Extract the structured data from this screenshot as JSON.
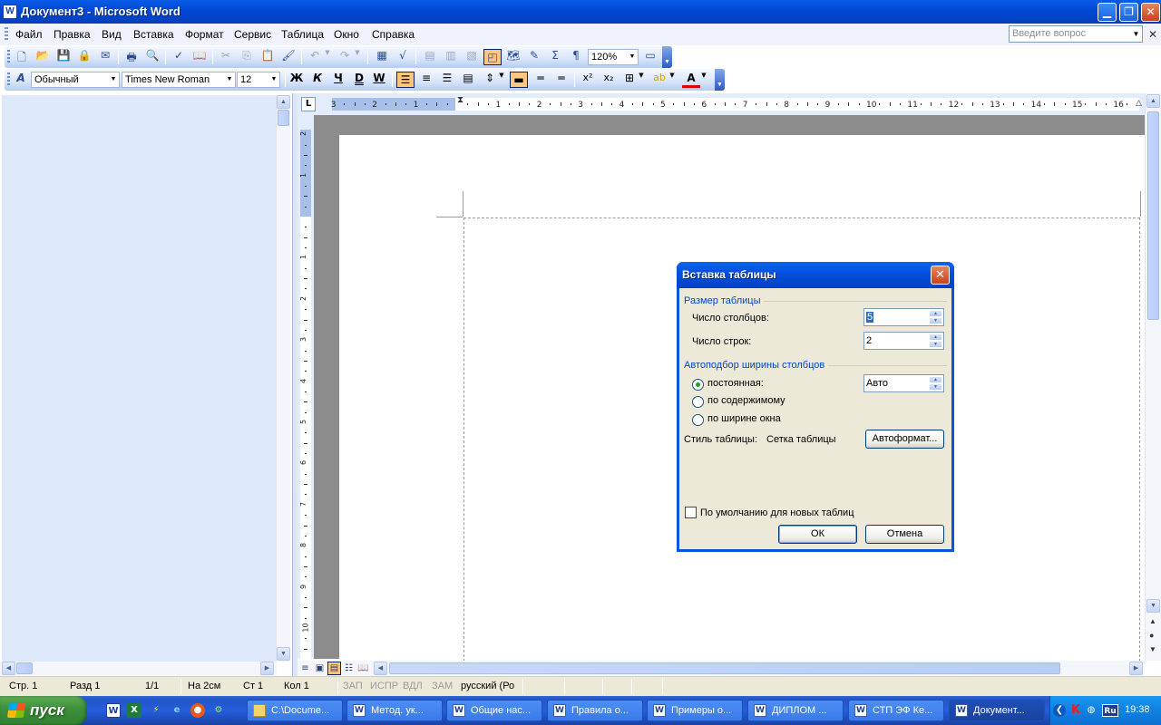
{
  "window": {
    "title": "Документ3 - Microsoft Word",
    "app_icon": "W"
  },
  "menu": {
    "items": [
      "Файл",
      "Правка",
      "Вид",
      "Вставка",
      "Формат",
      "Сервис",
      "Таблица",
      "Окно",
      "Справка"
    ],
    "ask_placeholder": "Введите вопрос"
  },
  "toolbar_standard": {
    "zoom": "120%"
  },
  "toolbar_formatting": {
    "style": "Обычный",
    "font": "Times New Roman",
    "size": "12"
  },
  "ruler": {
    "h_numbers": [
      "3",
      "2",
      "1",
      "1",
      "2",
      "3",
      "4",
      "5",
      "6",
      "7",
      "8",
      "9",
      "10",
      "11",
      "12",
      "13",
      "14",
      "15",
      "16"
    ],
    "v_numbers": [
      "2",
      "1",
      "1",
      "2",
      "3",
      "4",
      "5",
      "6",
      "7",
      "8",
      "9",
      "10"
    ]
  },
  "status": {
    "page": "Стр. 1",
    "section": "Разд 1",
    "pages": "1/1",
    "at": "На 2см",
    "line": "Ст 1",
    "col": "Кол 1",
    "rec": "ЗАП",
    "trk": "ИСПР",
    "ext": "ВДЛ",
    "ovr": "ЗАМ",
    "lang": "русский (Ро"
  },
  "taskbar": {
    "start": "пуск",
    "tasks": [
      "C:\\Docume...",
      "Метод. ук...",
      "Общие нас...",
      "Правила о...",
      "Примеры о...",
      "ДИПЛОМ ...",
      "СТП ЭФ Ке...",
      "Документ..."
    ],
    "clock": "19:38",
    "lang": "Ru"
  },
  "dialog": {
    "title": "Вставка таблицы",
    "size_group": "Размер таблицы",
    "columns_label": "Число столбцов:",
    "columns_value": "5",
    "rows_label": "Число строк:",
    "rows_value": "2",
    "autofit_group": "Автоподбор ширины столбцов",
    "fixed_label": "постоянная:",
    "fixed_value": "Авто",
    "content_label": "по содержимому",
    "window_label": "по ширине окна",
    "style_label": "Стиль таблицы:",
    "style_value": "Сетка таблицы",
    "autoformat_button": "Автоформат...",
    "default_label": "По умолчанию для новых таблиц",
    "ok_button": "ОК",
    "cancel_button": "Отмена"
  }
}
